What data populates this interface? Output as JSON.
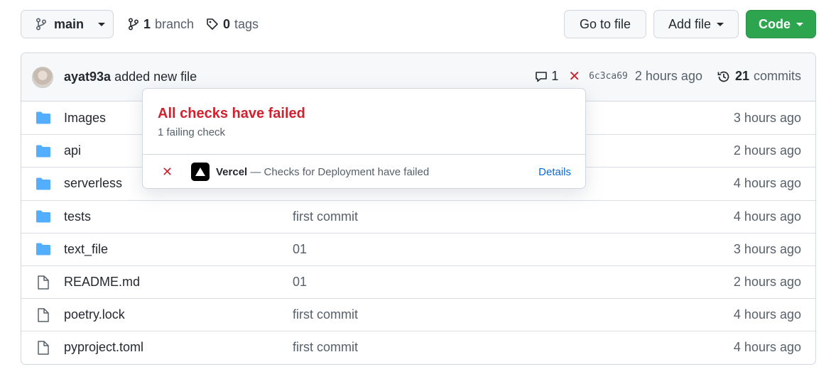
{
  "branch_select": {
    "label": "main"
  },
  "meta": {
    "branch_count": "1",
    "branch_label": "branch",
    "tag_count": "0",
    "tag_label": "tags"
  },
  "actions": {
    "go_to_file": "Go to file",
    "add_file": "Add file",
    "code": "Code"
  },
  "commit": {
    "author": "ayat93a",
    "message": "added new file",
    "comment_count": "1",
    "status_icon": "x-icon",
    "sha": "6c3ca69",
    "time": "2 hours ago",
    "commits_count": "21",
    "commits_label": "commits"
  },
  "files": [
    {
      "type": "folder",
      "name": "Images",
      "message": "",
      "age": "3 hours ago"
    },
    {
      "type": "folder",
      "name": "api",
      "message": "",
      "age": "2 hours ago"
    },
    {
      "type": "folder",
      "name": "serverless",
      "message": "",
      "age": "4 hours ago"
    },
    {
      "type": "folder",
      "name": "tests",
      "message": "first commit",
      "age": "4 hours ago"
    },
    {
      "type": "folder",
      "name": "text_file",
      "message": "01",
      "age": "3 hours ago"
    },
    {
      "type": "file",
      "name": "README.md",
      "message": "01",
      "age": "2 hours ago"
    },
    {
      "type": "file",
      "name": "poetry.lock",
      "message": "first commit",
      "age": "4 hours ago"
    },
    {
      "type": "file",
      "name": "pyproject.toml",
      "message": "first commit",
      "age": "4 hours ago"
    }
  ],
  "checks_popover": {
    "title": "All checks have failed",
    "subtitle": "1 failing check",
    "check": {
      "app": "Vercel",
      "description": " — Checks for Deployment have failed",
      "details": "Details"
    }
  },
  "colors": {
    "accent_green": "#2da44e",
    "fail_red": "#cf222e",
    "link_blue": "#0969da",
    "folder_blue": "#54aeff"
  }
}
